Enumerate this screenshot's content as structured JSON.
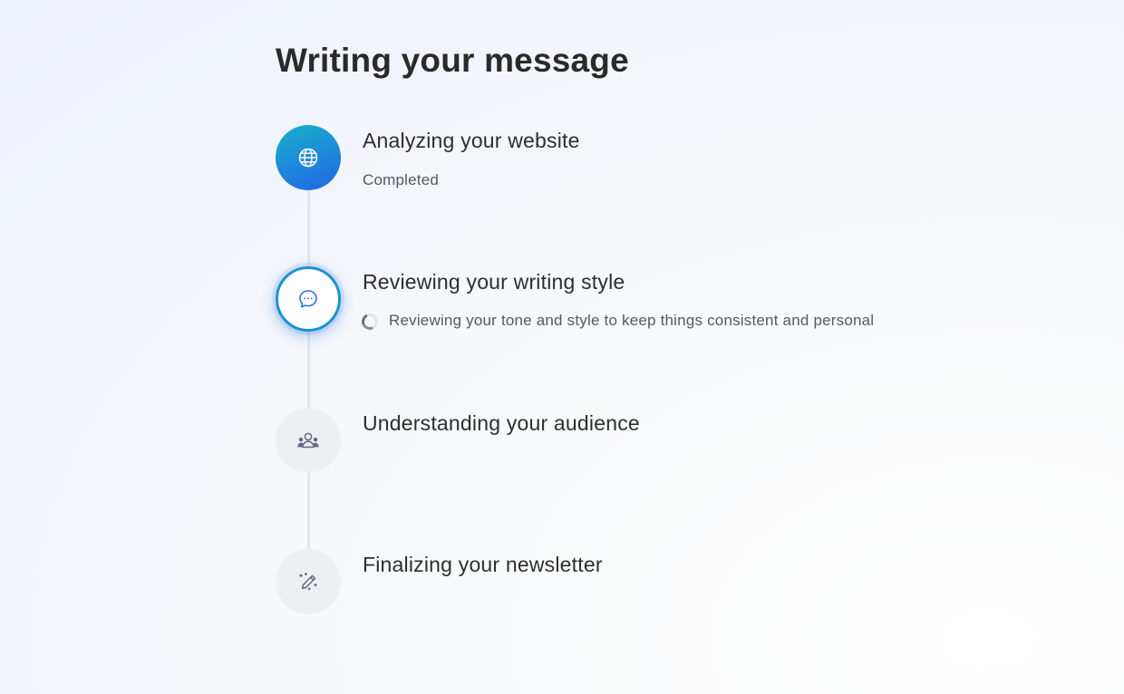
{
  "page": {
    "title": "Writing your message"
  },
  "steps": [
    {
      "title": "Analyzing your website",
      "status": "Completed",
      "state": "completed",
      "icon": "globe-icon"
    },
    {
      "title": "Reviewing your writing style",
      "status": "Reviewing your tone and style to keep things consistent and personal",
      "state": "in-progress",
      "icon": "chat-bubble-icon"
    },
    {
      "title": "Understanding your audience",
      "state": "pending",
      "icon": "audience-icon"
    },
    {
      "title": "Finalizing your newsletter",
      "state": "pending",
      "icon": "magic-pencil-icon"
    }
  ],
  "colors": {
    "accent_start": "#16b3c9",
    "accent_end": "#2267e4",
    "active_border": "#1a93d3",
    "pending_circle": "#eeeff2",
    "pending_icon": "#6a6585",
    "connector": "#e4e6ec"
  }
}
